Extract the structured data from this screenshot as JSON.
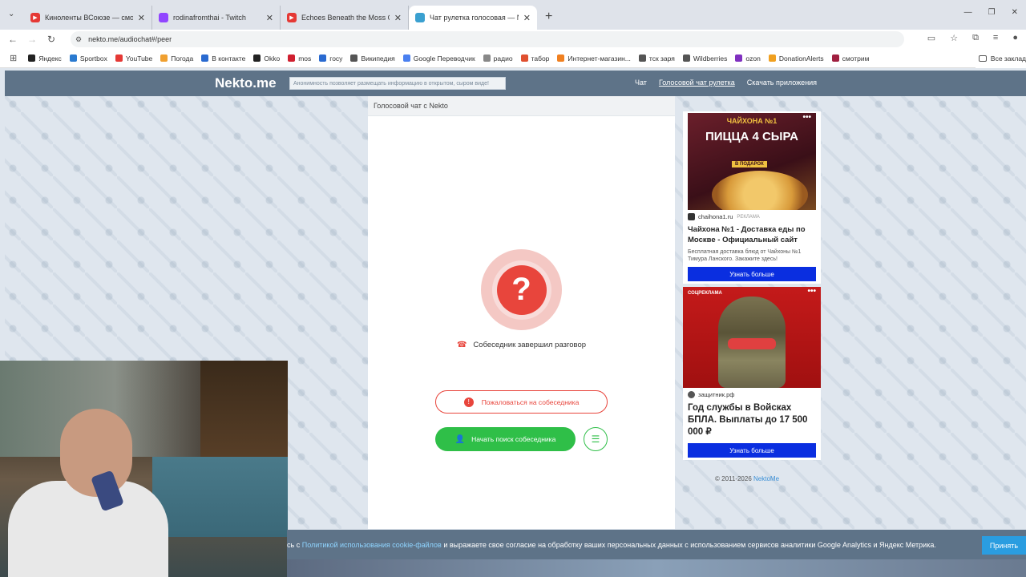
{
  "browser": {
    "tabs": [
      {
        "title": "Киноленты ВСоюзе — смотре",
        "color": "#e53935"
      },
      {
        "title": "rodinafromthai - Twitch",
        "color": "#9146ff"
      },
      {
        "title": "Echoes Beneath the Moss Orga",
        "color": "#e53935"
      },
      {
        "title": "Чат рулетка голосовая — Nek",
        "color": "#3aa0d0"
      }
    ],
    "new_tab": "+",
    "url": "nekto.me/audiochat#/peer",
    "bookmarks": [
      {
        "label": "Яндекс",
        "color": "#222"
      },
      {
        "label": "Sportbox",
        "color": "#2a7ad0"
      },
      {
        "label": "YouTube",
        "color": "#e53935"
      },
      {
        "label": "Погода",
        "color": "#f0a030"
      },
      {
        "label": "В контакте",
        "color": "#2a6ad0"
      },
      {
        "label": "Okko",
        "color": "#222"
      },
      {
        "label": "mos",
        "color": "#d02030"
      },
      {
        "label": "госу",
        "color": "#2a6ad0"
      },
      {
        "label": "Википедия",
        "color": "#555"
      },
      {
        "label": "Google Переводчик",
        "color": "#4a80f0"
      },
      {
        "label": "радио",
        "color": "#888"
      },
      {
        "label": "табор",
        "color": "#e05030"
      },
      {
        "label": "Интернет-магазин...",
        "color": "#f08020"
      },
      {
        "label": "тск заря",
        "color": "#555"
      },
      {
        "label": "Wildberries",
        "color": "#555"
      },
      {
        "label": "ozon",
        "color": "#8030c0"
      },
      {
        "label": "DonationAlerts",
        "color": "#f0a020"
      },
      {
        "label": "смотрим",
        "color": "#a02040"
      }
    ],
    "all_bookmarks": "Все заклад"
  },
  "site": {
    "logo": "Nekto.me",
    "notice": "Анонимность позволяет размещать информацию в открытом, сыром виде!",
    "nav": [
      "Чат",
      "Голосовой чат рулетка",
      "Скачать приложения"
    ]
  },
  "chat": {
    "header": "Голосовой чат с Nekto",
    "question_mark": "?",
    "status": "Собеседник завершил разговор",
    "report_button": "Пожаловаться на собеседника",
    "search_button": "Начать поиск собеседника"
  },
  "ads": {
    "ad1": {
      "brand": "ЧАЙХОНА №1",
      "promo": "ПИЦЦА 4 СЫРА",
      "gift": "В ПОДАРОК",
      "source": "chaihona1.ru",
      "mark": "РЕКЛАМА",
      "title": "Чайхона №1 - Доставка еды по Москве - Официальный сайт",
      "desc": "Бесплатная доставка блюд от Чайхоны №1 Тимура Ланского. Закажите здесь!",
      "button": "Узнать больше"
    },
    "ad2": {
      "tag": "СОЦРЕКЛАМА",
      "source": "защитник.рф",
      "title": "Год службы в Войсках БПЛА. Выплаты до 17 500 000 ₽",
      "button": "Узнать больше"
    },
    "dots": "•••"
  },
  "footer": {
    "copyright": "© 2011-2026",
    "link": "NektoMe"
  },
  "cookie": {
    "prefix": "сь с",
    "link": "Политикой использования cookie-файлов",
    "text": "и выражаете свое согласие на обработку ваших персональных данных с использованием сервисов аналитики Google Analytics и Яндекс Метрика.",
    "accept": "Принять"
  }
}
